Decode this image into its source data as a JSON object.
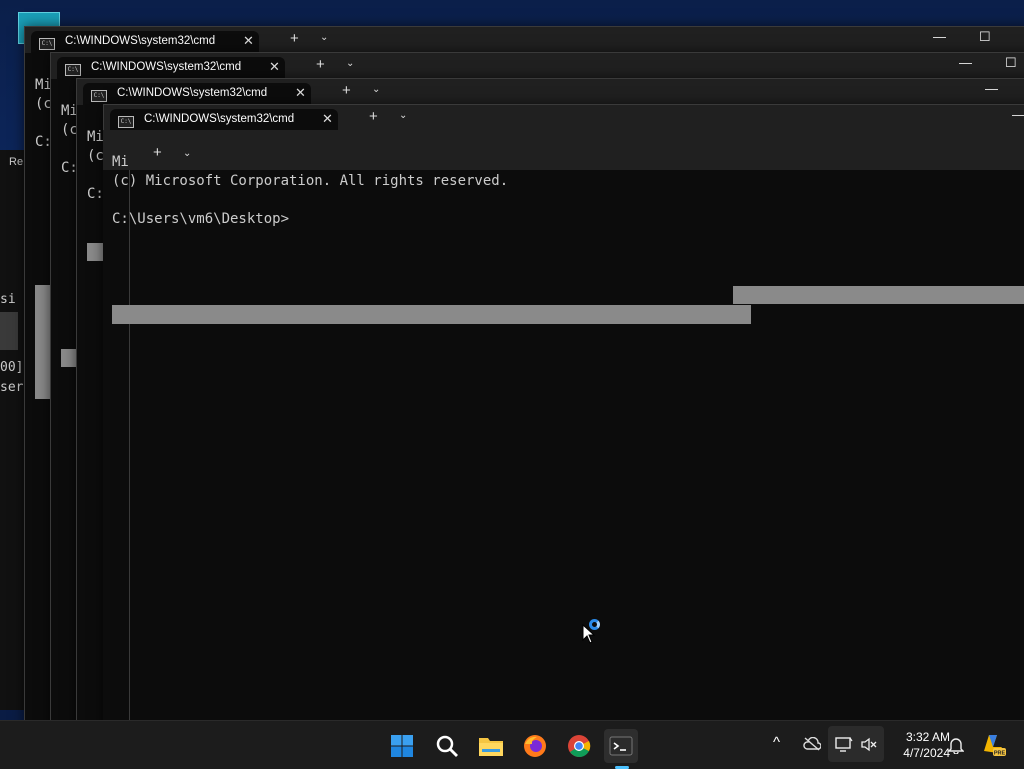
{
  "windows": {
    "tab_title": "C:\\WINDOWS\\system32\\cmd",
    "new_tab": "+",
    "dropdown": "⌄",
    "close": "✕",
    "minimize": "—",
    "maximize": "☐"
  },
  "back_text": {
    "w1_l1": "Mi",
    "w1_l2": "(c",
    "w1_l3": "C:",
    "w2_l1": "Mi",
    "w2_l2": "(c",
    "w2_l3": "C:",
    "w3_l1": "Mi",
    "w3_l2": "(c",
    "w3_l3": "C:",
    "front_l1": "Mi",
    "left_re": "Re",
    "left_si": "si",
    "left_00": "00]",
    "left_ser": "ser"
  },
  "terminal": {
    "copyright": "(c) Microsoft Corporation. All rights reserved.",
    "prompt": "C:\\Users\\vm6\\Desktop>"
  },
  "taskbar": {
    "apps": [
      "start-button",
      "search-button",
      "file-explorer-button",
      "firefox-button",
      "chrome-button",
      "terminal-button"
    ],
    "tray_chevron": "^",
    "time": "3:32 AM",
    "date": "4/7/2024",
    "colors": {
      "accent": "#0078d4",
      "taskbar": "#1c1c1c",
      "terminal_bg": "#0c0c0c"
    }
  }
}
